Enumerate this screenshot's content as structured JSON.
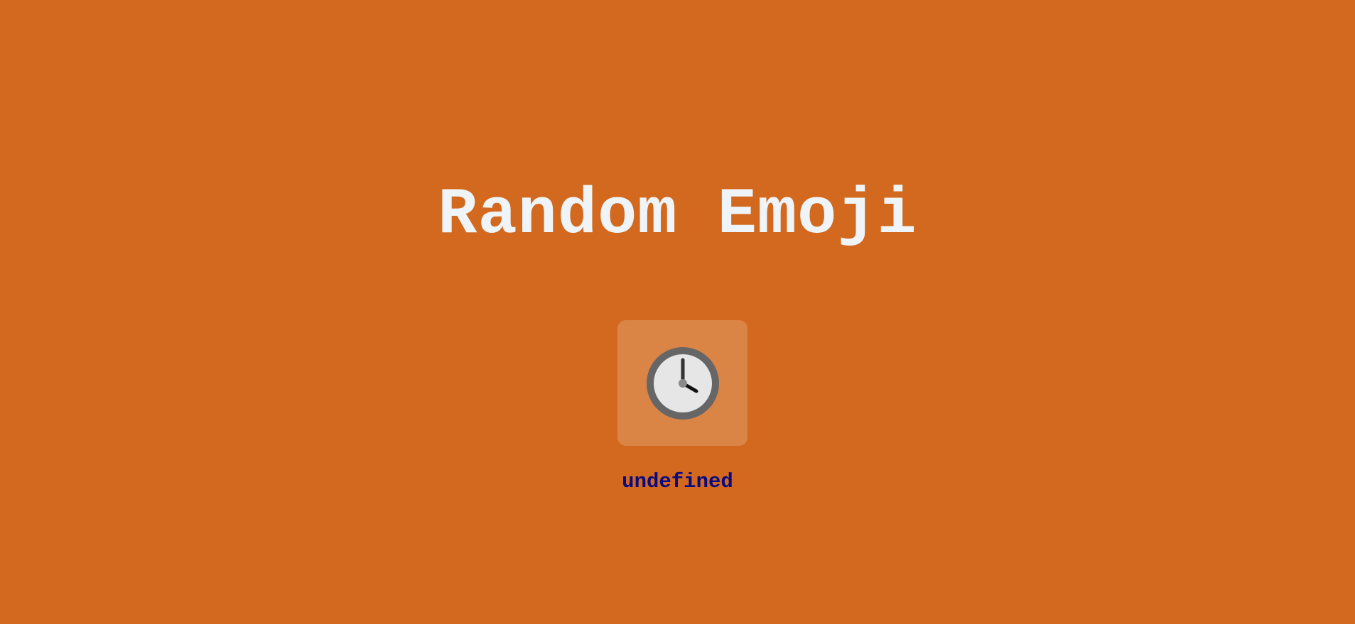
{
  "header": {
    "title": "Random Emoji"
  },
  "emoji": {
    "icon": "clock-four-oclock-icon",
    "name": "undefined"
  },
  "colors": {
    "background": "#d2691e",
    "title": "#eef4f8",
    "emoji_name": "#0a0a80",
    "clock_rim": "#666666",
    "clock_face": "#e6e6e6"
  }
}
